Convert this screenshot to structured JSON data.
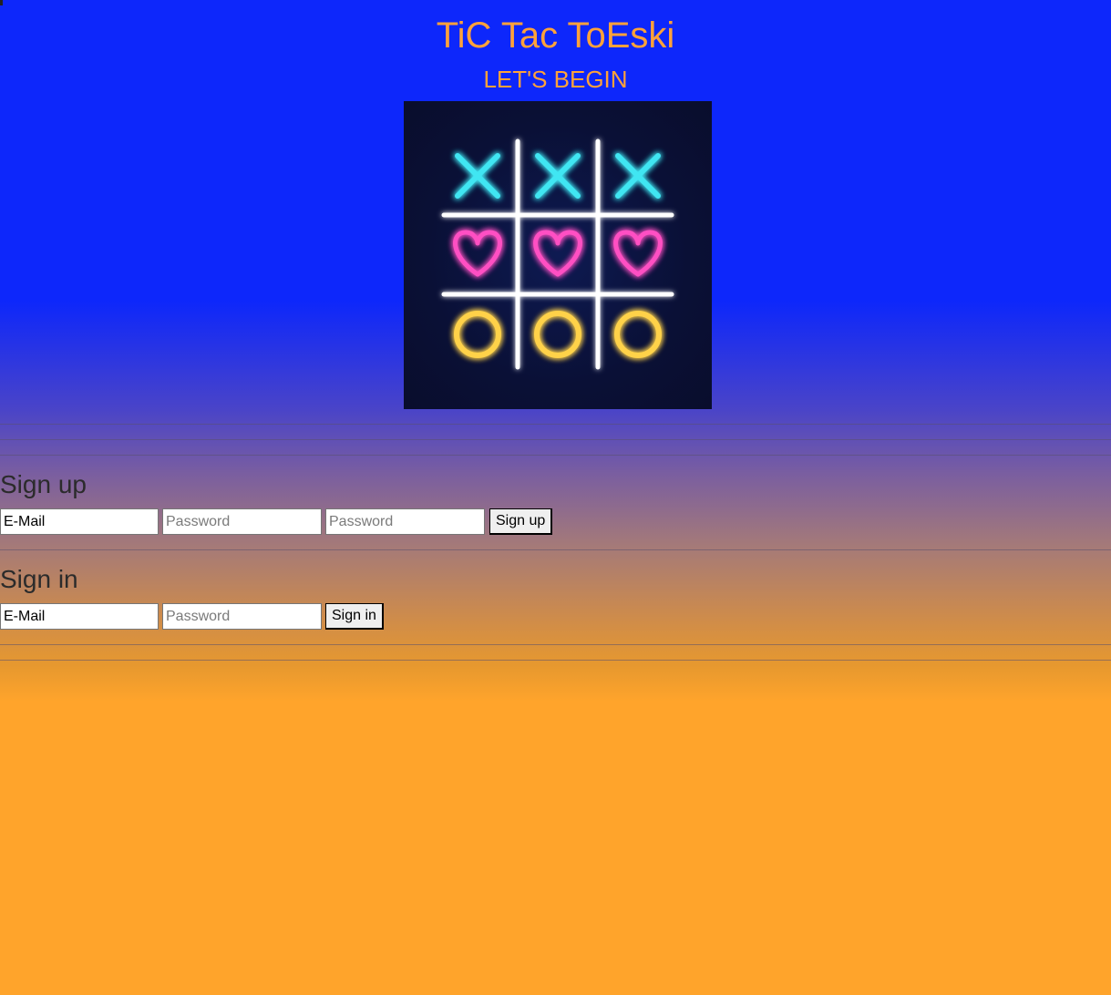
{
  "header": {
    "title": "TiC Tac ToEski",
    "subtitle": "LET'S BEGIN"
  },
  "colors": {
    "title": "#fea23a",
    "gradient_top": "#0d27fb",
    "gradient_bottom": "#ffa42b",
    "neon_x": "#3fe6f2",
    "neon_heart": "#ff4fc3",
    "neon_o": "#ffd24a",
    "neon_grid": "#ffffff"
  },
  "board": {
    "rows": [
      [
        "x-icon",
        "x-icon",
        "x-icon"
      ],
      [
        "heart-icon",
        "heart-icon",
        "heart-icon"
      ],
      [
        "o-icon",
        "o-icon",
        "o-icon"
      ]
    ]
  },
  "signup": {
    "heading": "Sign up",
    "email_value": "E-Mail",
    "password_placeholder": "Password",
    "confirm_placeholder": "Password",
    "button_label": "Sign up"
  },
  "signin": {
    "heading": "Sign in",
    "email_value": "E-Mail",
    "password_placeholder": "Password",
    "button_label": "Sign in"
  }
}
